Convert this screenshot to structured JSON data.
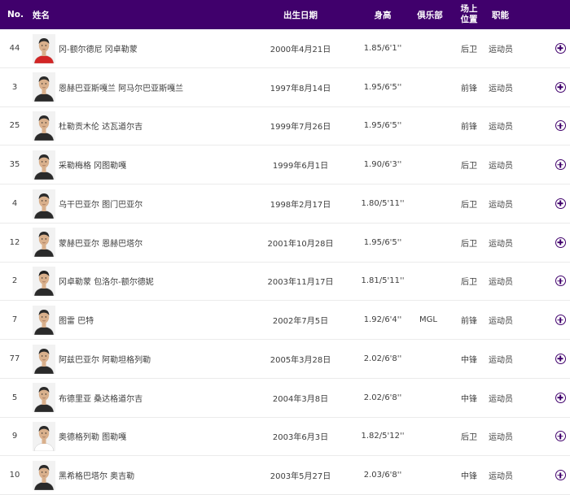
{
  "header": {
    "no": "No.",
    "name": "姓名",
    "dob": "出生日期",
    "height": "身高",
    "club": "俱乐部",
    "position_line1": "场上",
    "position_line2": "位置",
    "role": "职能"
  },
  "colors": {
    "header_bg": "#40006c",
    "accent": "#40006c"
  },
  "icons": {
    "expand": "plus-circle-icon",
    "photo": "player-photo"
  },
  "players": [
    {
      "no": "44",
      "name": "冈-额尔德尼 冈卓勒蒙",
      "dob": "2000年4月21日",
      "height": "1.85/6'1''",
      "club": "",
      "position": "后卫",
      "role": "运动员",
      "jersey": "#d32525",
      "hair": "#2a2a2a"
    },
    {
      "no": "3",
      "name": "恩赫巴亚斯嘎兰 阿马尔巴亚斯嘎兰",
      "dob": "1997年8月14日",
      "height": "1.95/6'5''",
      "club": "",
      "position": "前锋",
      "role": "运动员",
      "jersey": "#2a2a2a",
      "hair": "#2a2a2a"
    },
    {
      "no": "25",
      "name": "杜勒贡木伦 达瓦道尔吉",
      "dob": "1999年7月26日",
      "height": "1.95/6'5''",
      "club": "",
      "position": "前锋",
      "role": "运动员",
      "jersey": "#2a2a2a",
      "hair": "#2a2a2a"
    },
    {
      "no": "35",
      "name": "采勒梅格 冈图勒嘎",
      "dob": "1999年6月1日",
      "height": "1.90/6'3''",
      "club": "",
      "position": "后卫",
      "role": "运动员",
      "jersey": "#2a2a2a",
      "hair": "#2a2a2a"
    },
    {
      "no": "4",
      "name": "乌干巴亚尔 图门巴亚尔",
      "dob": "1998年2月17日",
      "height": "1.80/5'11''",
      "club": "",
      "position": "后卫",
      "role": "运动员",
      "jersey": "#2a2a2a",
      "hair": "#2a2a2a"
    },
    {
      "no": "12",
      "name": "蒙赫巴亚尔 恩赫巴塔尔",
      "dob": "2001年10月28日",
      "height": "1.95/6'5''",
      "club": "",
      "position": "后卫",
      "role": "运动员",
      "jersey": "#2a2a2a",
      "hair": "#2a2a2a"
    },
    {
      "no": "2",
      "name": "冈卓勒蒙 包洛尔-额尔德妮",
      "dob": "2003年11月17日",
      "height": "1.81/5'11''",
      "club": "",
      "position": "后卫",
      "role": "运动员",
      "jersey": "#2a2a2a",
      "hair": "#1e1e1e"
    },
    {
      "no": "7",
      "name": "图雷 巴特",
      "dob": "2002年7月5日",
      "height": "1.92/6'4''",
      "club": "MGL",
      "position": "前锋",
      "role": "运动员",
      "jersey": "#2a2a2a",
      "hair": "#2a2a2a"
    },
    {
      "no": "77",
      "name": "阿兹巴亚尔 阿勒坦格列勒",
      "dob": "2005年3月28日",
      "height": "2.02/6'8''",
      "club": "",
      "position": "中锋",
      "role": "运动员",
      "jersey": "#2a2a2a",
      "hair": "#2a2a2a"
    },
    {
      "no": "5",
      "name": "布德里亚 桑达格道尔吉",
      "dob": "2004年3月8日",
      "height": "2.02/6'8''",
      "club": "",
      "position": "中锋",
      "role": "运动员",
      "jersey": "#2a2a2a",
      "hair": "#2a2a2a"
    },
    {
      "no": "9",
      "name": "奥德格列勒 图勒嘎",
      "dob": "2003年6月3日",
      "height": "1.82/5'12''",
      "club": "",
      "position": "后卫",
      "role": "运动员",
      "jersey": "#ffffff",
      "hair": "#2a2a2a"
    },
    {
      "no": "10",
      "name": "黑希格巴塔尔 奥吉勒",
      "dob": "2003年5月27日",
      "height": "2.03/6'8''",
      "club": "",
      "position": "中锋",
      "role": "运动员",
      "jersey": "#2a2a2a",
      "hair": "#2a2a2a"
    }
  ]
}
